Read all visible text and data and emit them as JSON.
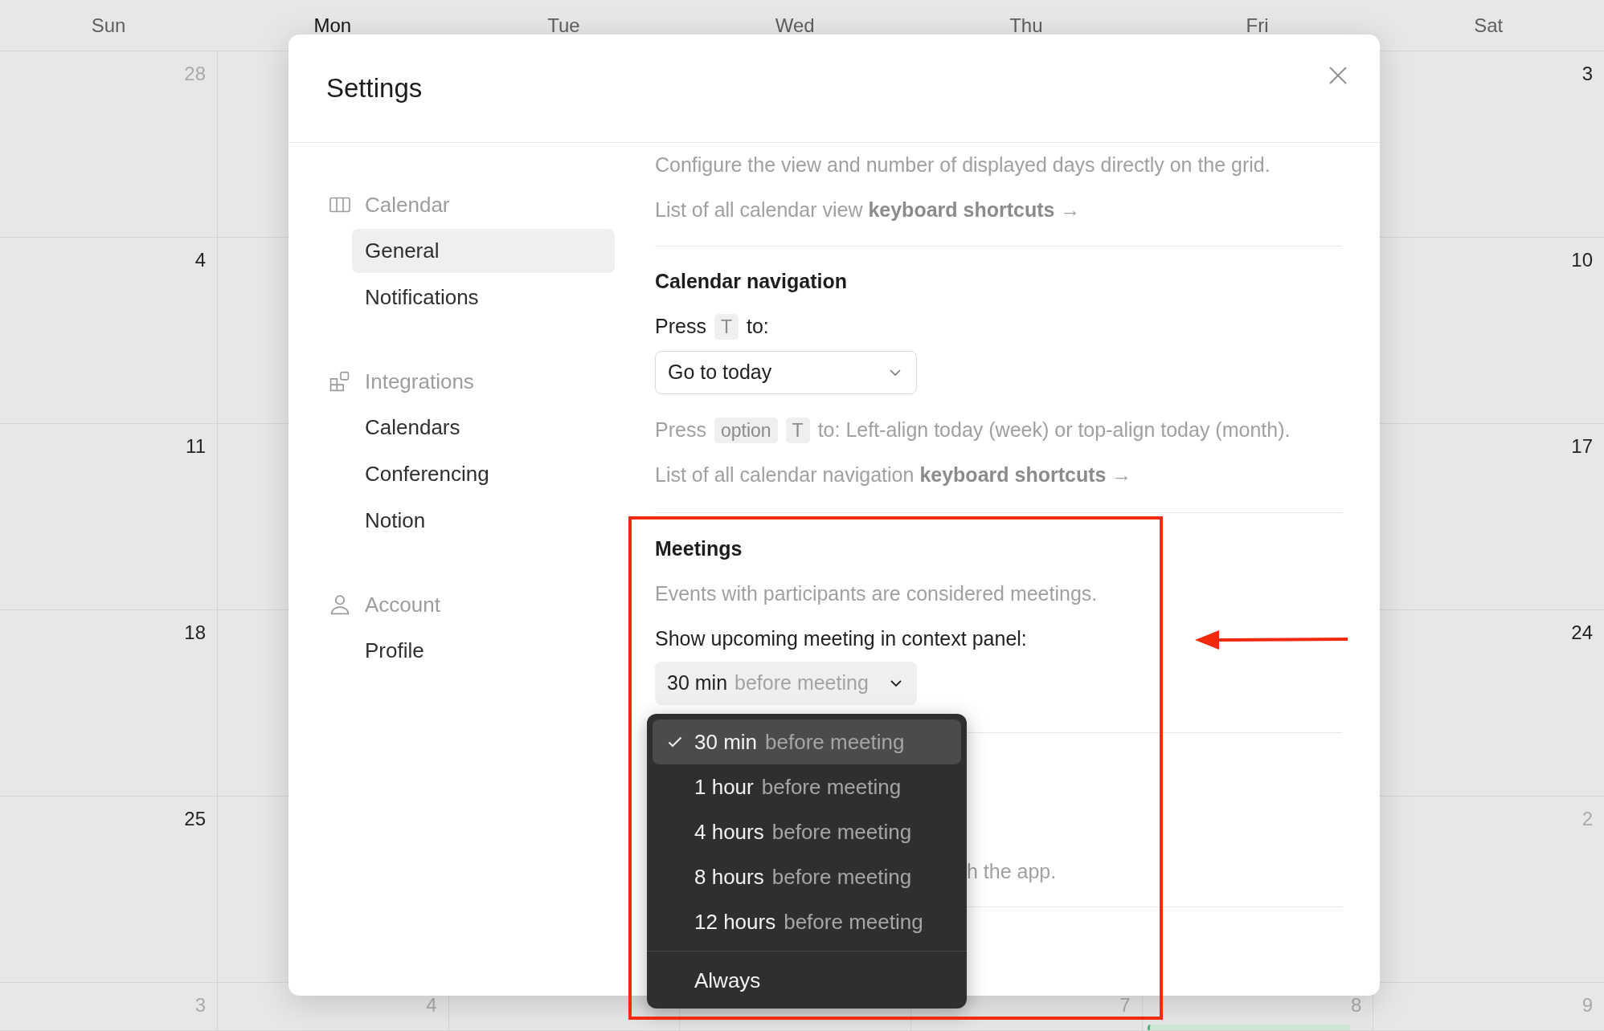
{
  "calendar": {
    "weekdays": [
      {
        "label": "Sun",
        "today": false
      },
      {
        "label": "Mon",
        "today": true
      },
      {
        "label": "Tue",
        "today": false
      },
      {
        "label": "Wed",
        "today": false
      },
      {
        "label": "Thu",
        "today": false
      },
      {
        "label": "Fri",
        "today": false
      },
      {
        "label": "Sat",
        "today": false
      }
    ],
    "weeks": [
      {
        "sun": {
          "date": "28",
          "muted": true
        },
        "sat": {
          "date": "3",
          "muted": false
        }
      },
      {
        "sun": {
          "date": "4",
          "muted": false
        },
        "sat": {
          "date": "10",
          "muted": false
        }
      },
      {
        "sun": {
          "date": "11",
          "muted": false
        },
        "sat": {
          "date": "17",
          "muted": false
        }
      },
      {
        "sun": {
          "date": "18",
          "muted": false
        },
        "sat": {
          "date": "24",
          "muted": false
        }
      },
      {
        "sun": {
          "date": "25",
          "muted": false
        },
        "sat": {
          "date": "2",
          "muted": true
        }
      },
      {
        "sun": {
          "date": "3",
          "muted": true
        },
        "mon": {
          "date": "4",
          "muted": true
        },
        "thu": {
          "date": "7",
          "muted": true
        },
        "fri": {
          "date": "8",
          "muted": true,
          "has_event": true
        },
        "sat": {
          "date": "9",
          "muted": true
        }
      }
    ]
  },
  "settings": {
    "title": "Settings",
    "sidebar": {
      "sections": [
        {
          "label": "Calendar",
          "items": [
            {
              "label": "General",
              "selected": true
            },
            {
              "label": "Notifications",
              "selected": false
            }
          ]
        },
        {
          "label": "Integrations",
          "items": [
            {
              "label": "Calendars",
              "selected": false
            },
            {
              "label": "Conferencing",
              "selected": false
            },
            {
              "label": "Notion",
              "selected": false
            }
          ]
        },
        {
          "label": "Account",
          "items": [
            {
              "label": "Profile",
              "selected": false
            }
          ]
        }
      ]
    },
    "content": {
      "view_section": {
        "description": "Configure the view and number of displayed days directly on the grid.",
        "link": "List of all calendar view **keyboard shortcuts** →"
      },
      "navigation_section": {
        "heading": "Calendar navigation",
        "prompt": [
          {
            "kind": "text",
            "text": "Press"
          },
          {
            "kind": "key",
            "text": "T"
          },
          {
            "kind": "text",
            "text": "to:"
          }
        ],
        "select": {
          "value": "Go to today"
        },
        "hint": [
          {
            "kind": "text",
            "text": "Press"
          },
          {
            "kind": "key",
            "text": "option"
          },
          {
            "kind": "key",
            "text": "T"
          },
          {
            "kind": "text",
            "text": "to: Left-align today (week) or top-align today (month)."
          }
        ],
        "link": "List of all calendar navigation **keyboard shortcuts** →"
      },
      "meetings_section": {
        "heading": "Meetings",
        "description": "Events with participants are considered meetings.",
        "label": "Show upcoming meeting in context panel:",
        "select": {
          "value": "30 min",
          "suffix": "before meeting"
        },
        "menu": [
          {
            "kind": "option",
            "label": "30 min",
            "suffix": "before meeting",
            "selected": true
          },
          {
            "kind": "option",
            "label": "1 hour",
            "suffix": "before meeting",
            "selected": false
          },
          {
            "kind": "option",
            "label": "4 hours",
            "suffix": "before meeting",
            "selected": false
          },
          {
            "kind": "option",
            "label": "8 hours",
            "suffix": "before meeting",
            "selected": false
          },
          {
            "kind": "option",
            "label": "12 hours",
            "suffix": "before meeting",
            "selected": false
          },
          {
            "kind": "separator"
          },
          {
            "kind": "option",
            "label": "Always",
            "selected": false
          }
        ]
      },
      "covered_section": {
        "text": "h the app."
      }
    }
  },
  "annotations": {
    "highlight_box": true,
    "arrow": true
  }
}
